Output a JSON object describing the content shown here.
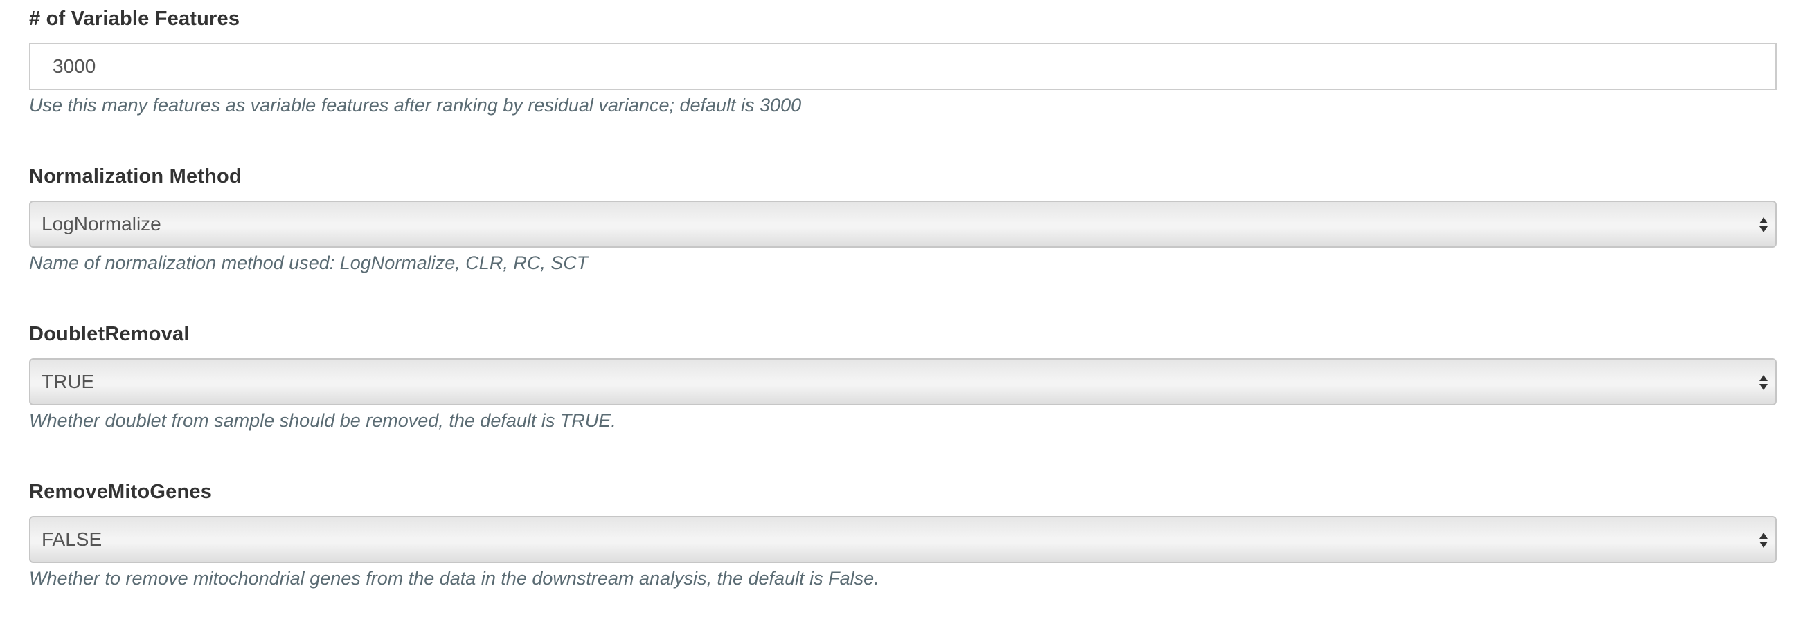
{
  "fields": [
    {
      "label": "# of Variable Features",
      "type": "text",
      "value": "3000",
      "help": "Use this many features as variable features after ranking by residual variance; default is 3000"
    },
    {
      "label": "Normalization Method",
      "type": "select",
      "value": "LogNormalize",
      "help": "Name of normalization method used: LogNormalize, CLR, RC, SCT"
    },
    {
      "label": "DoubletRemoval",
      "type": "select",
      "value": "TRUE",
      "help": "Whether doublet from sample should be removed, the default is TRUE."
    },
    {
      "label": "RemoveMitoGenes",
      "type": "select",
      "value": "FALSE",
      "help": "Whether to remove mitochondrial genes from the data in the downstream analysis, the default is False."
    }
  ],
  "icons": {
    "select_arrow": "updown-caret-icon"
  },
  "colors": {
    "label": "#333333",
    "help_text": "#5a6b73",
    "input_border": "#cccccc",
    "select_gradient_top": "#e6e6e6",
    "select_gradient_bottom": "#dedede"
  }
}
